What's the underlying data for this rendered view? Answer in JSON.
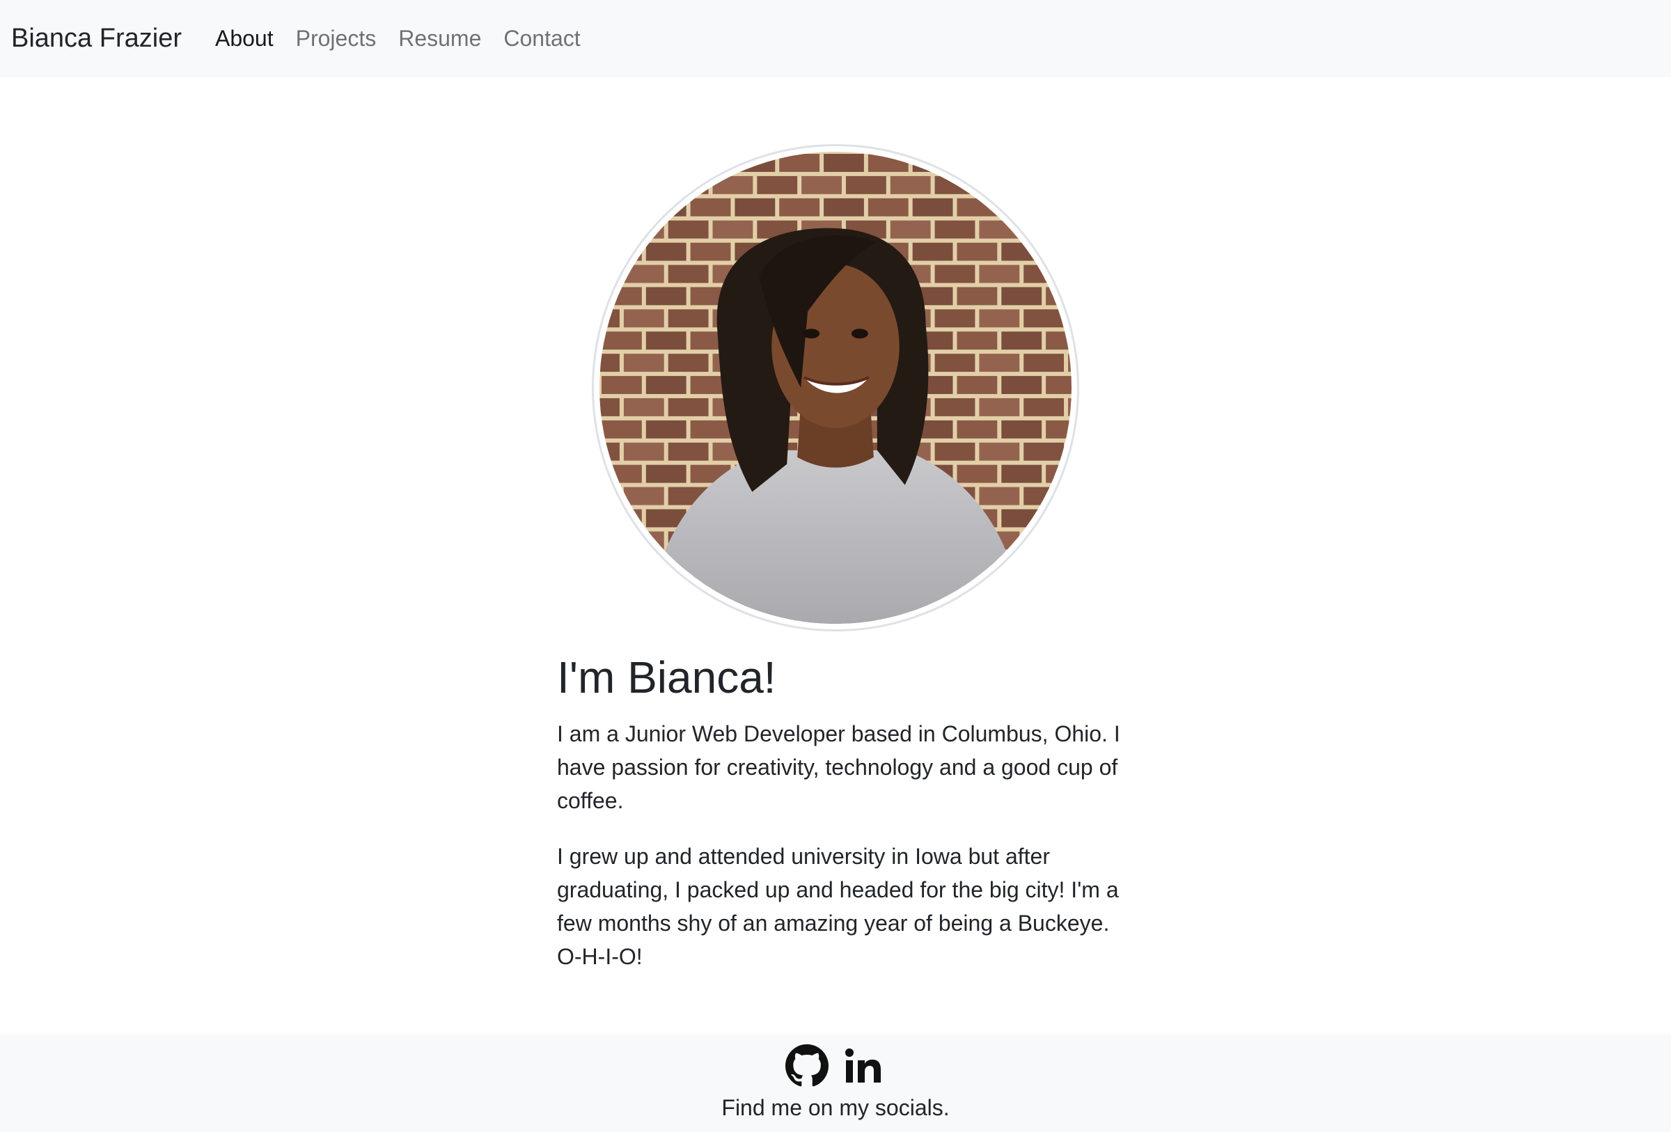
{
  "navbar": {
    "brand": "Bianca Frazier",
    "links": [
      {
        "label": "About",
        "active": true
      },
      {
        "label": "Projects",
        "active": false
      },
      {
        "label": "Resume",
        "active": false
      },
      {
        "label": "Contact",
        "active": false
      }
    ]
  },
  "profile": {
    "photo_icon": "profile-photo"
  },
  "main": {
    "heading": "I'm Bianca!",
    "paragraphs": [
      "I am a Junior Web Developer based in Columbus, Ohio. I have passion for creativity, technology and a good cup of coffee.",
      "I grew up and attended university in Iowa but after graduating, I packed up and headed for the big city! I'm a few months shy of an amazing year of being a Buckeye. O-H-I-O!"
    ]
  },
  "footer": {
    "icons": [
      "github-icon",
      "linkedin-icon"
    ],
    "text": "Find me on my socials."
  },
  "colors": {
    "navbar_bg": "#f8f9fa",
    "text": "#212529",
    "nav_muted": "#737373",
    "nav_active": "#1a1a1a"
  }
}
